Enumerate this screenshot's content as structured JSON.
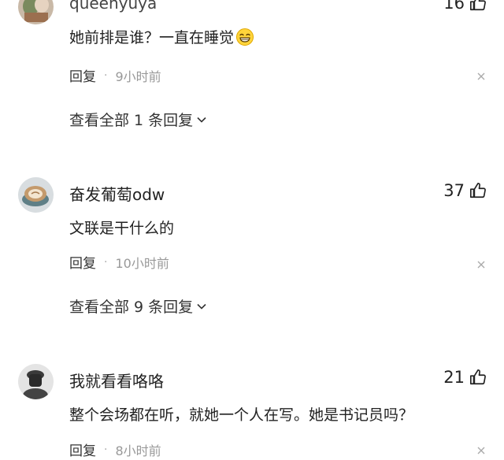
{
  "comments": [
    {
      "username": "queenyuya",
      "likes": "16",
      "text": "她前排是谁？一直在睡觉",
      "emoji": "grin-emoji",
      "reply_label": "回复",
      "dot": "·",
      "time": "9小时前",
      "view_replies": "查看全部 1 条回复"
    },
    {
      "username": "奋发葡萄odw",
      "likes": "37",
      "text": "文联是干什么的",
      "reply_label": "回复",
      "dot": "·",
      "time": "10小时前",
      "view_replies": "查看全部 9 条回复"
    },
    {
      "username": "我就看看咯咯",
      "likes": "21",
      "text": "整个会场都在听，就她一个人在写。她是书记员吗？",
      "reply_label": "回复",
      "dot": "·",
      "time": "8小时前"
    }
  ],
  "icons": {
    "like": "thumbs-up-icon",
    "close": "close-icon",
    "expand": "chevron-down-icon"
  },
  "colors": {
    "text": "#222222",
    "meta": "#999999",
    "background": "#ffffff"
  }
}
